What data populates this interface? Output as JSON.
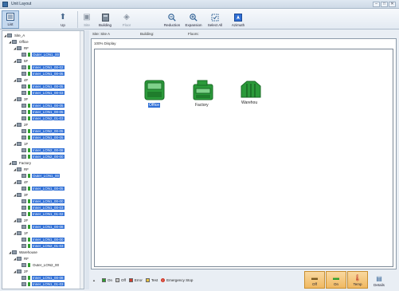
{
  "window": {
    "title": "Unit Layout",
    "controls": [
      "–",
      "□",
      "✕"
    ]
  },
  "toolbar": {
    "list": "List",
    "up": "Up",
    "site": "Site",
    "building": "Building",
    "floor": "Floor",
    "reduction": "Reduction",
    "expansion": "Expansion",
    "select_all": "Select All",
    "azimuth": "Azimuth"
  },
  "breadcrumb": {
    "site": "Site: Site A",
    "building": "Building:",
    "floors": "Floors:"
  },
  "zoom": "100% Display",
  "tree": [
    {
      "indent": 0,
      "twisty": "◢",
      "icon": "folder",
      "label": "Site_A",
      "sel": false
    },
    {
      "indent": 1,
      "twisty": "◢",
      "icon": "folder",
      "label": "Office",
      "sel": false
    },
    {
      "indent": 2,
      "twisty": "◢",
      "icon": "folder",
      "label": "RF",
      "sel": false
    },
    {
      "indent": 3,
      "twisty": "",
      "icon": "device",
      "label": "Outer_LON1_00",
      "sel": true
    },
    {
      "indent": 2,
      "twisty": "◢",
      "icon": "folder",
      "label": "5F",
      "sel": false
    },
    {
      "indent": 3,
      "twisty": "",
      "icon": "device",
      "label": "Inner_LON1_00-02",
      "sel": true
    },
    {
      "indent": 3,
      "twisty": "",
      "icon": "device",
      "label": "Inner_LON1_00-05",
      "sel": true
    },
    {
      "indent": 2,
      "twisty": "◢",
      "icon": "folder",
      "label": "4F",
      "sel": false
    },
    {
      "indent": 3,
      "twisty": "",
      "icon": "device",
      "label": "Inner_LON1_00-05",
      "sel": true
    },
    {
      "indent": 3,
      "twisty": "",
      "icon": "device",
      "label": "Inner_LON1_00-03",
      "sel": true
    },
    {
      "indent": 2,
      "twisty": "◢",
      "icon": "folder",
      "label": "3F",
      "sel": false
    },
    {
      "indent": 3,
      "twisty": "",
      "icon": "device",
      "label": "Inner_LON1_00-05",
      "sel": true
    },
    {
      "indent": 3,
      "twisty": "",
      "icon": "device",
      "label": "Inner_LON1_00-05",
      "sel": true
    },
    {
      "indent": 3,
      "twisty": "",
      "icon": "device",
      "label": "Inner_LON2_01-03",
      "sel": true
    },
    {
      "indent": 2,
      "twisty": "◢",
      "icon": "folder",
      "label": "2F",
      "sel": false
    },
    {
      "indent": 3,
      "twisty": "",
      "icon": "device",
      "label": "Inner_LON2_00-05",
      "sel": true
    },
    {
      "indent": 3,
      "twisty": "",
      "icon": "device",
      "label": "Inner_LON1_00-05",
      "sel": true
    },
    {
      "indent": 2,
      "twisty": "◢",
      "icon": "folder",
      "label": "1F",
      "sel": false
    },
    {
      "indent": 3,
      "twisty": "",
      "icon": "device",
      "label": "Inner_LON2_00-08",
      "sel": true
    },
    {
      "indent": 3,
      "twisty": "",
      "icon": "device",
      "label": "Inner_LON2_00-00",
      "sel": true
    },
    {
      "indent": 1,
      "twisty": "◢",
      "icon": "folder",
      "label": "Factory",
      "sel": false
    },
    {
      "indent": 2,
      "twisty": "◢",
      "icon": "folder",
      "label": "RF",
      "sel": false
    },
    {
      "indent": 3,
      "twisty": "",
      "icon": "device",
      "label": "Outer_LON1_00",
      "sel": true
    },
    {
      "indent": 2,
      "twisty": "◢",
      "icon": "folder",
      "label": "4F",
      "sel": false
    },
    {
      "indent": 3,
      "twisty": "",
      "icon": "device",
      "label": "Inner_LON1_00-05",
      "sel": true
    },
    {
      "indent": 2,
      "twisty": "◢",
      "icon": "folder",
      "label": "3F",
      "sel": false
    },
    {
      "indent": 3,
      "twisty": "",
      "icon": "device",
      "label": "Inner_LON1_00-00",
      "sel": true
    },
    {
      "indent": 3,
      "twisty": "",
      "icon": "device",
      "label": "Inner_LON1_00-03",
      "sel": true
    },
    {
      "indent": 3,
      "twisty": "",
      "icon": "device",
      "label": "Inner_LON1_01-02",
      "sel": true
    },
    {
      "indent": 2,
      "twisty": "◢",
      "icon": "folder",
      "label": "2F",
      "sel": false
    },
    {
      "indent": 3,
      "twisty": "",
      "icon": "device",
      "label": "Inner_LON1_00-08",
      "sel": true
    },
    {
      "indent": 2,
      "twisty": "◢",
      "icon": "folder",
      "label": "1F",
      "sel": false
    },
    {
      "indent": 3,
      "twisty": "",
      "icon": "device",
      "label": "Inner_LON1_00-00",
      "sel": true
    },
    {
      "indent": 3,
      "twisty": "",
      "icon": "device",
      "label": "Inner_LON2_01-03",
      "sel": true
    },
    {
      "indent": 1,
      "twisty": "◢",
      "icon": "folder",
      "label": "Warehouse",
      "sel": false
    },
    {
      "indent": 2,
      "twisty": "◢",
      "icon": "folder",
      "label": "RF",
      "sel": false
    },
    {
      "indent": 3,
      "twisty": "",
      "icon": "device",
      "label": "Outer_LON2_00",
      "sel": false
    },
    {
      "indent": 2,
      "twisty": "◢",
      "icon": "folder",
      "label": "2F",
      "sel": false
    },
    {
      "indent": 3,
      "twisty": "",
      "icon": "device",
      "label": "Inner_LON1_00-08",
      "sel": true
    },
    {
      "indent": 3,
      "twisty": "",
      "icon": "device",
      "label": "Inner_LON1_01-03",
      "sel": true
    },
    {
      "indent": 2,
      "twisty": "◢",
      "icon": "folder",
      "label": "1F",
      "sel": false
    }
  ],
  "buildings": [
    {
      "label": "Office",
      "selected": true,
      "icon": "office-building-icon"
    },
    {
      "label": "Factory",
      "selected": false,
      "icon": "factory-building-icon"
    },
    {
      "label": "Warehou",
      "selected": false,
      "icon": "warehouse-building-icon"
    }
  ],
  "legend": {
    "on": "On",
    "off": "Off",
    "error": "Error",
    "test": "Test",
    "emergency": "Emergency Stop"
  },
  "status_buttons": {
    "off": "Off",
    "on": "On",
    "temp": "Temp",
    "details": "Details"
  },
  "colors": {
    "on": "#2fa02f",
    "off": "#c8c8c8",
    "error": "#d23b2b",
    "test": "#e8c340",
    "selection": "#2f6fd6",
    "building": "#2b9a3a"
  }
}
